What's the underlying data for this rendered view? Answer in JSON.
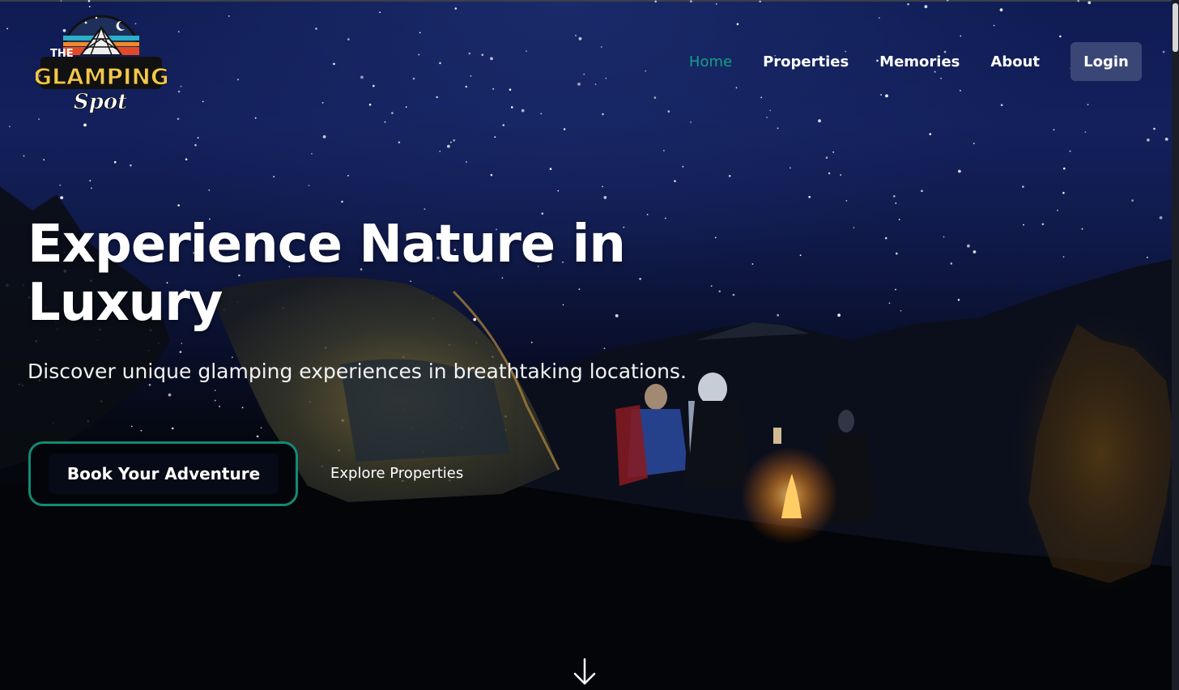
{
  "logo": {
    "line1": "THE",
    "line2": "GLAMPING",
    "line3": "Spot"
  },
  "nav": {
    "items": [
      {
        "label": "Home",
        "active": true
      },
      {
        "label": "Properties",
        "active": false
      },
      {
        "label": "Memories",
        "active": false
      },
      {
        "label": "About",
        "active": false
      }
    ],
    "login_label": "Login"
  },
  "hero": {
    "title": "Experience Nature in Luxury",
    "subtitle": "Discover unique glamping experiences in breathtaking locations.",
    "primary_cta": "Book Your Adventure",
    "secondary_cta": "Explore Properties",
    "scroll_icon": "arrow-down-icon"
  },
  "colors": {
    "accent": "#14a085",
    "login_bg": "#3a4675",
    "sky_top": "#0f1b52"
  }
}
